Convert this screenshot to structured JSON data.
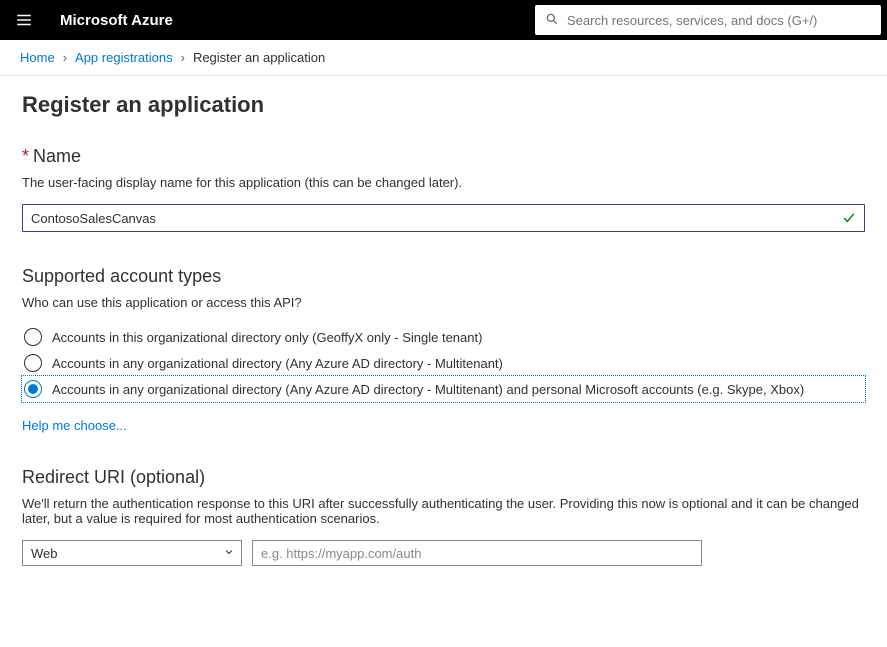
{
  "brand": "Microsoft Azure",
  "search": {
    "placeholder": "Search resources, services, and docs (G+/)"
  },
  "breadcrumb": {
    "items": [
      {
        "label": "Home",
        "link": true
      },
      {
        "label": "App registrations",
        "link": true
      },
      {
        "label": "Register an application",
        "link": false
      }
    ]
  },
  "page": {
    "title": "Register an application"
  },
  "name_section": {
    "header": "Name",
    "desc": "The user-facing display name for this application (this can be changed later).",
    "value": "ContosoSalesCanvas"
  },
  "account_types": {
    "header": "Supported account types",
    "desc": "Who can use this application or access this API?",
    "options": [
      "Accounts in this organizational directory only (GeoffyX only - Single tenant)",
      "Accounts in any organizational directory (Any Azure AD directory - Multitenant)",
      "Accounts in any organizational directory (Any Azure AD directory - Multitenant) and personal Microsoft accounts (e.g. Skype, Xbox)"
    ],
    "selected_index": 2,
    "help_link": "Help me choose..."
  },
  "redirect": {
    "header": "Redirect URI (optional)",
    "desc": "We'll return the authentication response to this URI after successfully authenticating the user. Providing this now is optional and it can be changed later, but a value is required for most authentication scenarios.",
    "type_selected": "Web",
    "uri_placeholder": "e.g. https://myapp.com/auth",
    "uri_value": ""
  }
}
